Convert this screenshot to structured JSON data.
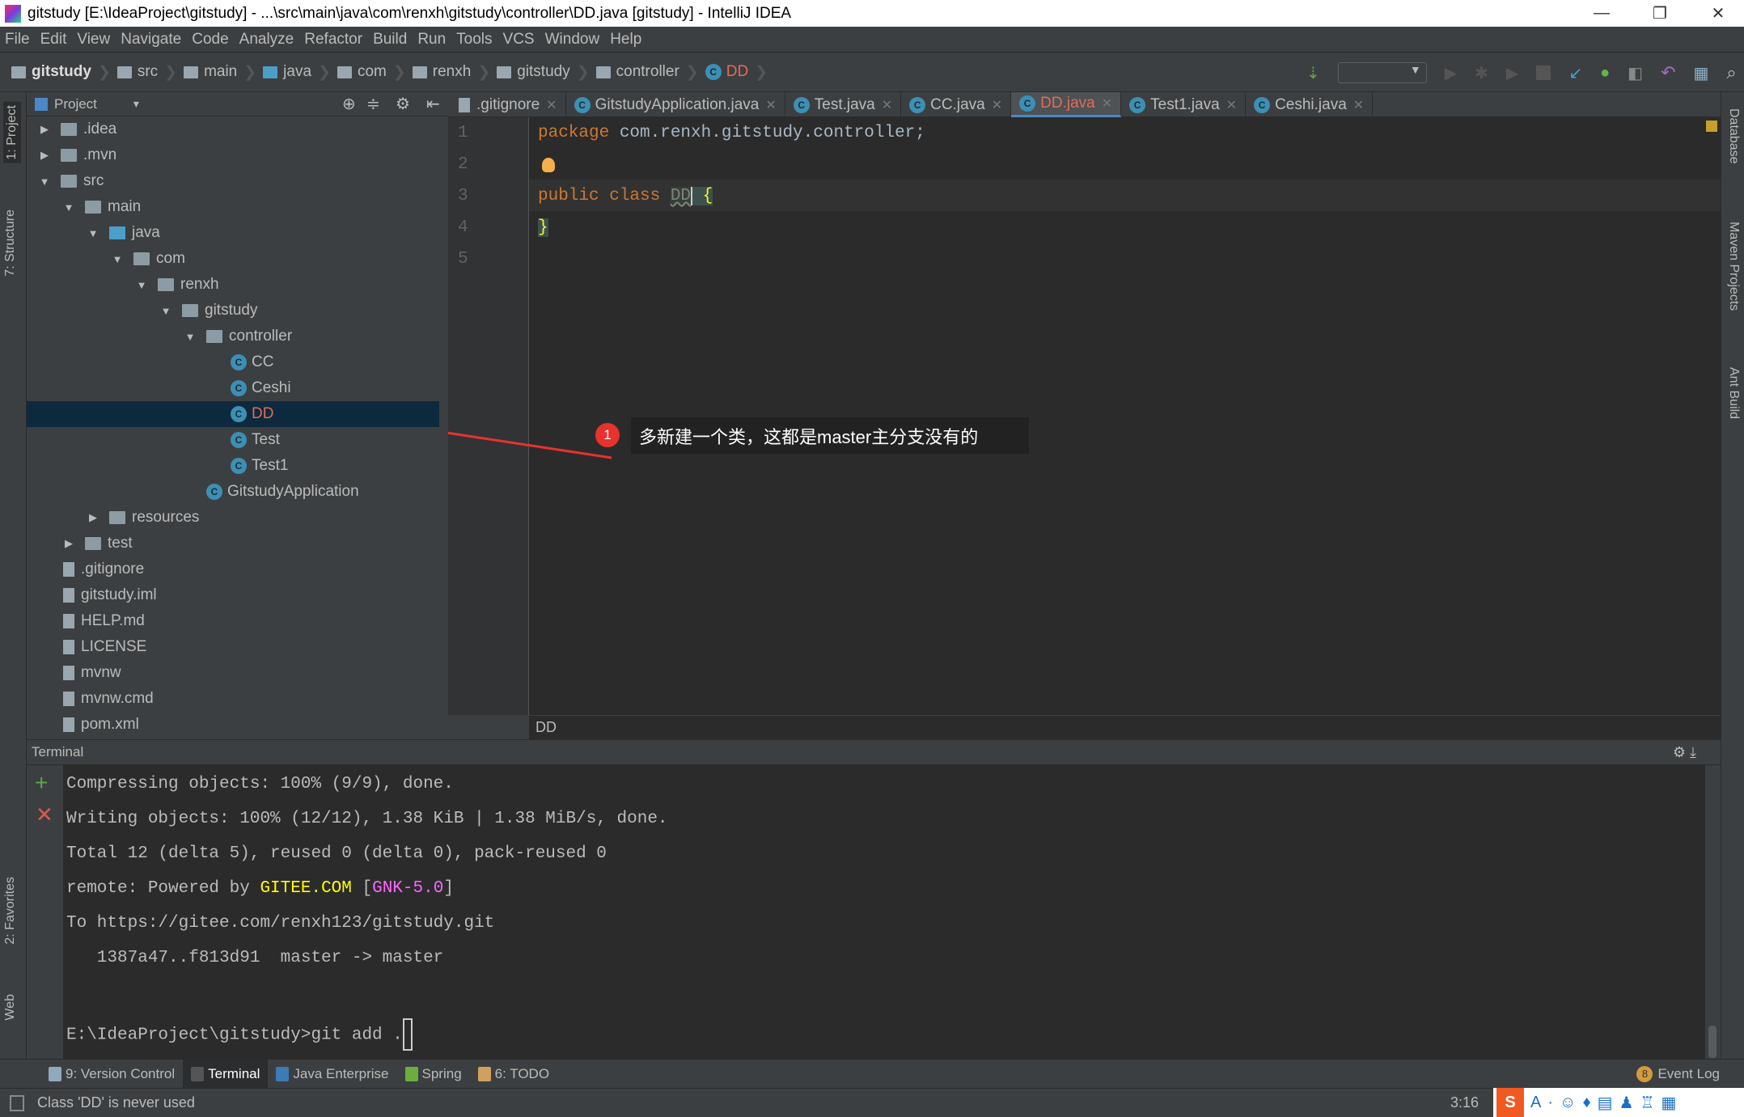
{
  "window": {
    "title": "gitstudy [E:\\IdeaProject\\gitstudy] - ...\\src\\main\\java\\com\\renxh\\gitstudy\\controller\\DD.java [gitstudy] - IntelliJ IDEA",
    "minimize": "—",
    "restore": "❐",
    "close": "✕"
  },
  "menu": [
    "File",
    "Edit",
    "View",
    "Navigate",
    "Code",
    "Analyze",
    "Refactor",
    "Build",
    "Run",
    "Tools",
    "VCS",
    "Window",
    "Help"
  ],
  "breadcrumb": [
    "gitstudy",
    "src",
    "main",
    "java",
    "com",
    "renxh",
    "gitstudy",
    "controller",
    "DD"
  ],
  "left_tools": {
    "project": "1: Project",
    "structure": "7: Structure",
    "favorites": "2: Favorites",
    "web": "Web"
  },
  "right_tools": {
    "database": "Database",
    "maven": "Maven Projects",
    "ant": "Ant Build"
  },
  "project_panel": {
    "title": "Project",
    "dropdown": "▾"
  },
  "tree": [
    {
      "label": ".idea",
      "depth": 0,
      "arrow": "▶",
      "type": "folder"
    },
    {
      "label": ".mvn",
      "depth": 0,
      "arrow": "▶",
      "type": "folder"
    },
    {
      "label": "src",
      "depth": 0,
      "arrow": "▼",
      "type": "folder"
    },
    {
      "label": "main",
      "depth": 1,
      "arrow": "▼",
      "type": "folder"
    },
    {
      "label": "java",
      "depth": 2,
      "arrow": "▼",
      "type": "folder-blue"
    },
    {
      "label": "com",
      "depth": 3,
      "arrow": "▼",
      "type": "package"
    },
    {
      "label": "renxh",
      "depth": 4,
      "arrow": "▼",
      "type": "package"
    },
    {
      "label": "gitstudy",
      "depth": 5,
      "arrow": "▼",
      "type": "package"
    },
    {
      "label": "controller",
      "depth": 6,
      "arrow": "▼",
      "type": "package"
    },
    {
      "label": "CC",
      "depth": 7,
      "arrow": "",
      "type": "class"
    },
    {
      "label": "Ceshi",
      "depth": 7,
      "arrow": "",
      "type": "class"
    },
    {
      "label": "DD",
      "depth": 7,
      "arrow": "",
      "type": "class",
      "selected": true
    },
    {
      "label": "Test",
      "depth": 7,
      "arrow": "",
      "type": "class"
    },
    {
      "label": "Test1",
      "depth": 7,
      "arrow": "",
      "type": "class"
    },
    {
      "label": "GitstudyApplication",
      "depth": 6,
      "arrow": "",
      "type": "class"
    },
    {
      "label": "resources",
      "depth": 2,
      "arrow": "▶",
      "type": "folder"
    },
    {
      "label": "test",
      "depth": 1,
      "arrow": "▶",
      "type": "folder"
    },
    {
      "label": ".gitignore",
      "depth": 0,
      "arrow": "",
      "type": "file"
    },
    {
      "label": "gitstudy.iml",
      "depth": 0,
      "arrow": "",
      "type": "file"
    },
    {
      "label": "HELP.md",
      "depth": 0,
      "arrow": "",
      "type": "file"
    },
    {
      "label": "LICENSE",
      "depth": 0,
      "arrow": "",
      "type": "file"
    },
    {
      "label": "mvnw",
      "depth": 0,
      "arrow": "",
      "type": "file"
    },
    {
      "label": "mvnw.cmd",
      "depth": 0,
      "arrow": "",
      "type": "file"
    },
    {
      "label": "pom.xml",
      "depth": 0,
      "arrow": "",
      "type": "file"
    }
  ],
  "tabs": [
    {
      "label": ".gitignore"
    },
    {
      "label": "GitstudyApplication.java"
    },
    {
      "label": "Test.java"
    },
    {
      "label": "CC.java"
    },
    {
      "label": "DD.java",
      "active": true
    },
    {
      "label": "Test1.java"
    },
    {
      "label": "Ceshi.java"
    }
  ],
  "editor": {
    "line_numbers": [
      "1",
      "2",
      "3",
      "4",
      "5"
    ],
    "line1_kw": "package",
    "line1_rest": " com.renxh.gitstudy.controller;",
    "line3_kw": "public class ",
    "line3_name": "DD",
    "line3_brace": " {",
    "line4": "}",
    "breadcrumb": "DD"
  },
  "terminal": {
    "title": "Terminal",
    "lines": [
      "Compressing objects: 100% (9/9), done.",
      "Writing objects: 100% (12/12), 1.38 KiB | 1.38 MiB/s, done.",
      "Total 12 (delta 5), reused 0 (delta 0), pack-reused 0"
    ],
    "remote_prefix": "remote: Powered by ",
    "remote_gitee": "GITEE.COM",
    "remote_lb": " [",
    "remote_gnk": "GNK-5.0",
    "remote_rb": "]",
    "to_line": "To https://gitee.com/renxh123/gitstudy.git",
    "hash_line": "   1387a47..f813d91  master -> master",
    "prompt": "E:\\IdeaProject\\gitstudy>git add ."
  },
  "tool_windows": [
    {
      "label": "9: Version Control",
      "color": "#8fa9bd"
    },
    {
      "label": "Terminal",
      "color": "#555",
      "active": true
    },
    {
      "label": "Java Enterprise",
      "color": "#3d7ab8"
    },
    {
      "label": "Spring",
      "color": "#6aaf3d"
    },
    {
      "label": "6: TODO",
      "color": "#d0a060"
    }
  ],
  "event_log": {
    "count": "8",
    "label": "Event Log"
  },
  "status": {
    "message": "Class 'DD' is never used",
    "position": "3:16"
  },
  "annotation": {
    "number": "1",
    "text": "多新建一个类，这都是master主分支没有的",
    "color": "#e8322d"
  }
}
